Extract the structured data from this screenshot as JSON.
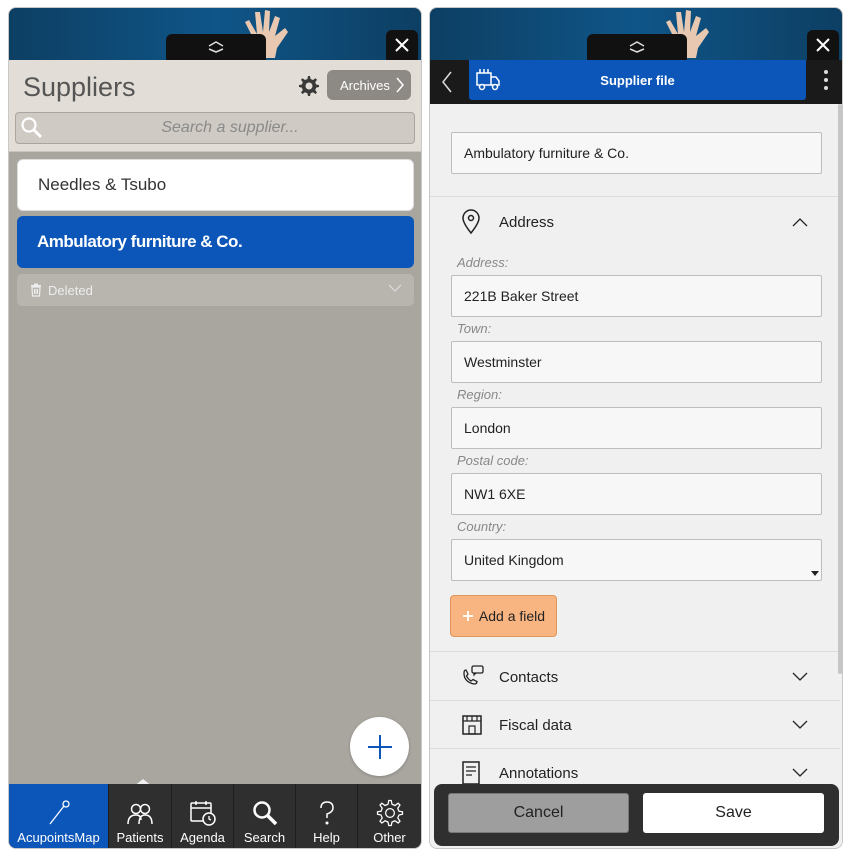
{
  "left": {
    "title": "Suppliers",
    "archives_label": "Archives",
    "search_placeholder": "Search a supplier...",
    "suppliers": [
      "Needles & Tsubo",
      "Ambulatory furniture & Co."
    ],
    "deleted_label": "Deleted",
    "nav": [
      {
        "label": "AcupointsMap",
        "icon": "acupuncture-needle-icon",
        "active": true
      },
      {
        "label": "Patients",
        "icon": "patients-icon"
      },
      {
        "label": "Agenda",
        "icon": "calendar-icon"
      },
      {
        "label": "Search",
        "icon": "search-icon"
      },
      {
        "label": "Help",
        "icon": "help-icon"
      },
      {
        "label": "Other",
        "icon": "gear-icon"
      }
    ]
  },
  "right": {
    "header_title": "Supplier file",
    "name_value": "Ambulatory furniture & Co.",
    "address_section": "Address",
    "fields": {
      "address_label": "Address:",
      "address_value": "221B Baker Street",
      "town_label": "Town:",
      "town_value": "Westminster",
      "region_label": "Region:",
      "region_value": "London",
      "postal_label": "Postal code:",
      "postal_value": "NW1 6XE",
      "country_label": "Country:",
      "country_value": "United Kingdom"
    },
    "add_field_label": "Add a field",
    "sections": [
      "Contacts",
      "Fiscal data",
      "Annotations"
    ],
    "cancel_label": "Cancel",
    "save_label": "Save"
  },
  "colors": {
    "accent": "#0b56b8",
    "add_field": "#f8b481",
    "nav_bg": "#2f2f2f"
  }
}
